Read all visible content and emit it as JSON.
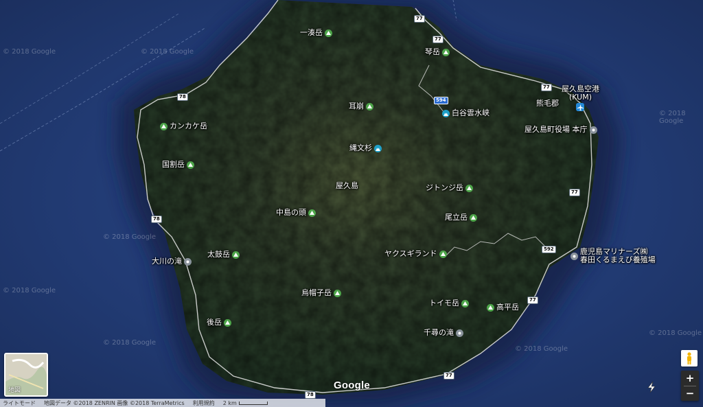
{
  "map": {
    "mountains": [
      {
        "id": "ichiminato",
        "label": "一湊岳"
      },
      {
        "id": "kotodake",
        "label": "琴岳"
      },
      {
        "id": "mimikuzure",
        "label": "耳崩"
      },
      {
        "id": "kankake",
        "label": "カンカケ岳"
      },
      {
        "id": "kunwari",
        "label": "国割岳"
      },
      {
        "id": "shitonji",
        "label": "ジトンジ岳"
      },
      {
        "id": "nakadake",
        "label": "中島の頭"
      },
      {
        "id": "tatedake",
        "label": "尾立岳"
      },
      {
        "id": "taiko",
        "label": "太鼓岳"
      },
      {
        "id": "eboshi",
        "label": "烏帽子岳"
      },
      {
        "id": "toimo",
        "label": "トイモ岳"
      },
      {
        "id": "koheidake",
        "label": "高平岳"
      },
      {
        "id": "atodake",
        "label": "後岳"
      },
      {
        "id": "yakusugiland",
        "label": "ヤクスギランド"
      }
    ],
    "parks": [
      {
        "id": "shiratani",
        "label": "白谷雲水峡"
      },
      {
        "id": "jomonsugi",
        "label": "縄文杉"
      }
    ],
    "pois": [
      {
        "id": "okonotaki",
        "label": "大川の滝"
      },
      {
        "id": "senpiro",
        "label": "千尋の滝"
      },
      {
        "id": "townhall",
        "label": "屋久島町役場 本庁"
      },
      {
        "id": "kagoshima-marinars-1",
        "label": "鹿児島マリナーズ㈱"
      },
      {
        "id": "kagoshima-marinars-2",
        "label": "春田くるまえび養殖場"
      }
    ],
    "airport": {
      "line1": "屋久島空港",
      "line2": "(KUM)"
    },
    "places": {
      "island": "屋久島",
      "district": "熊毛郡"
    },
    "routes": [
      "77",
      "77",
      "77",
      "77",
      "77",
      "77",
      "78",
      "78",
      "78",
      "594",
      "592"
    ],
    "watermark": "© 2018 Google",
    "logo": "Google"
  },
  "thumbnail": {
    "label": "地図"
  },
  "footer": {
    "mode": "ライトモード",
    "attribution": "地図データ ©2018 ZENRIN 画像 ©2018 TerraMetrics",
    "terms": "利用規約",
    "scale": "2 km"
  },
  "controls": {
    "zoom_in": "+",
    "zoom_out": "−"
  },
  "colors": {
    "sea": "#1e3566",
    "land": "#2f3d2c",
    "mountain_icon": "#4ea54a",
    "park_icon": "#1fa0c8",
    "poi_icon": "#8a939c"
  }
}
